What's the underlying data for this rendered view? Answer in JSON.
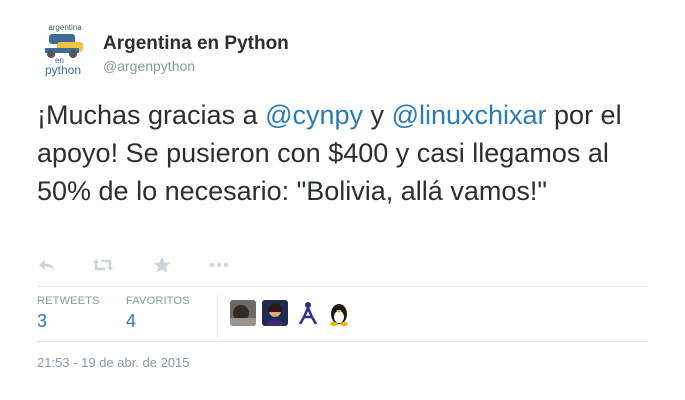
{
  "account": {
    "name": "Argentina en Python",
    "handle": "@argenpython",
    "avatar_text_top": "argentina",
    "avatar_text_mid": "en",
    "avatar_text_bottom": "python"
  },
  "tweet": {
    "part1": "¡Muchas gracias a ",
    "mention1": "@cynpy",
    "part2": " y ",
    "mention2": "@linuxchixar",
    "part3": " por el apoyo! Se pusieron con $400 y casi llegamos al 50% de lo necesario: \"Bolivia, allá vamos!\""
  },
  "actions": [
    "reply-icon",
    "retweet-icon",
    "favorite-icon",
    "more-icon"
  ],
  "stats": {
    "retweets_label": "RETWEETS",
    "retweets_count": "3",
    "favorites_label": "FAVORITOS",
    "favorites_count": "4"
  },
  "favoriters": [
    "user-avatar-1",
    "user-avatar-2",
    "user-avatar-3",
    "user-avatar-4"
  ],
  "timestamp": "21:53 - 19 de abr. de 2015",
  "colors": {
    "link": "#2b7bb9",
    "text": "#292f33",
    "muted": "#8899a6",
    "divider": "#e1e8ed"
  }
}
